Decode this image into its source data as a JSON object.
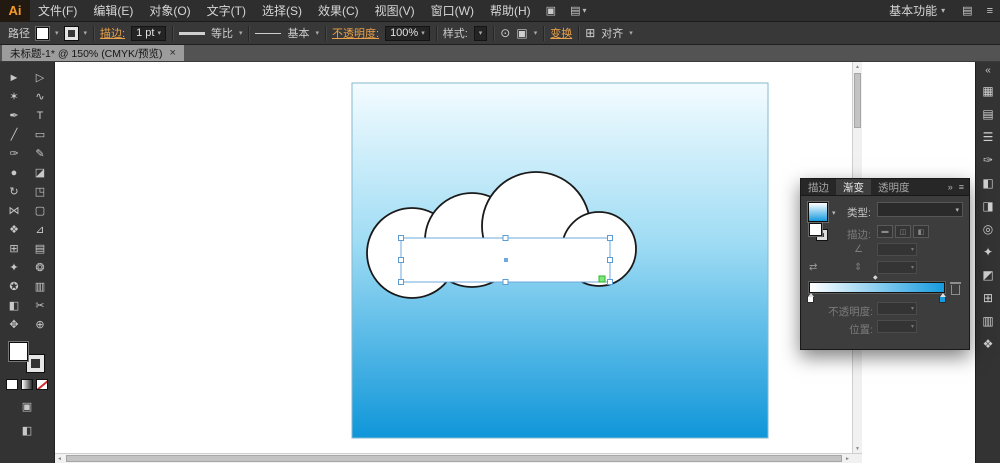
{
  "app": {
    "logo": "Ai",
    "workspace_label": "基本功能"
  },
  "icons": {
    "caret_down": "▾",
    "close": "×",
    "collapse": "»",
    "expand": "«",
    "panel_menu": "≡",
    "angle": "∠",
    "reverse": "⇄",
    "aspect": "⇕",
    "recolor": "⊙",
    "doc": "▣",
    "grid": "▤",
    "align": "⊞",
    "up_arrow": "▲",
    "down_arrow": "▼",
    "left_arrow": "◄",
    "right_arrow": "►",
    "diamond": "◆"
  },
  "menubar": {
    "items": [
      "文件(F)",
      "编辑(E)",
      "对象(O)",
      "文字(T)",
      "选择(S)",
      "效果(C)",
      "视图(V)",
      "窗口(W)",
      "帮助(H)"
    ],
    "arrange_icon": "▣",
    "layout_icon": "▤"
  },
  "controlbar": {
    "selection_label": "路径",
    "stroke_label": "描边:",
    "stroke_value": "1 pt",
    "profile_value": "等比",
    "brush_value": "基本",
    "opacity_label": "不透明度:",
    "opacity_value": "100%",
    "style_label": "样式:",
    "transform_label": "变换",
    "align_label": "对齐"
  },
  "tabbar": {
    "title": "未标题-1* @ 150% (CMYK/预览)"
  },
  "tools": {
    "glyphs": [
      "►",
      "▷",
      "✶",
      "∿",
      "✒",
      "T",
      "╱",
      "▭",
      "✑",
      "✎",
      "●",
      "◪",
      "↻",
      "◳",
      "⋈",
      "▢",
      "❖",
      "⊿",
      "⊞",
      "▤",
      "✦",
      "❂",
      "✪",
      "▥",
      "◧",
      "✂",
      "✥",
      "⊕"
    ],
    "draw_mode_glyph": "▣",
    "screen_mode_glyph": "◧"
  },
  "dock": {
    "glyphs": [
      "▦",
      "▤",
      "☰",
      "✑",
      "◧",
      "◨",
      "◎",
      "✦",
      "◩",
      "⊞",
      "▥",
      "❖"
    ]
  },
  "panel": {
    "tabs": [
      "描边",
      "渐变",
      "透明度"
    ],
    "active_tab": "渐变",
    "type_label": "类型:",
    "stroke_label": "描边:",
    "opacity_label": "不透明度:",
    "location_label": "位置:",
    "stroke_button_glyphs": [
      "▬",
      "◫",
      "◧"
    ],
    "gradient_start": "#ffffff",
    "gradient_end": "#169bdf"
  },
  "canvas": {
    "sky_top": "#f4fcff",
    "sky_mid": "#9fdcf4",
    "sky_bottom": "#0f96d9",
    "cloud_fill": "#ffffff",
    "cloud_stroke": "#1a1a1a",
    "selection_color": "#6fa8dc",
    "snap_color": "#39d339"
  }
}
